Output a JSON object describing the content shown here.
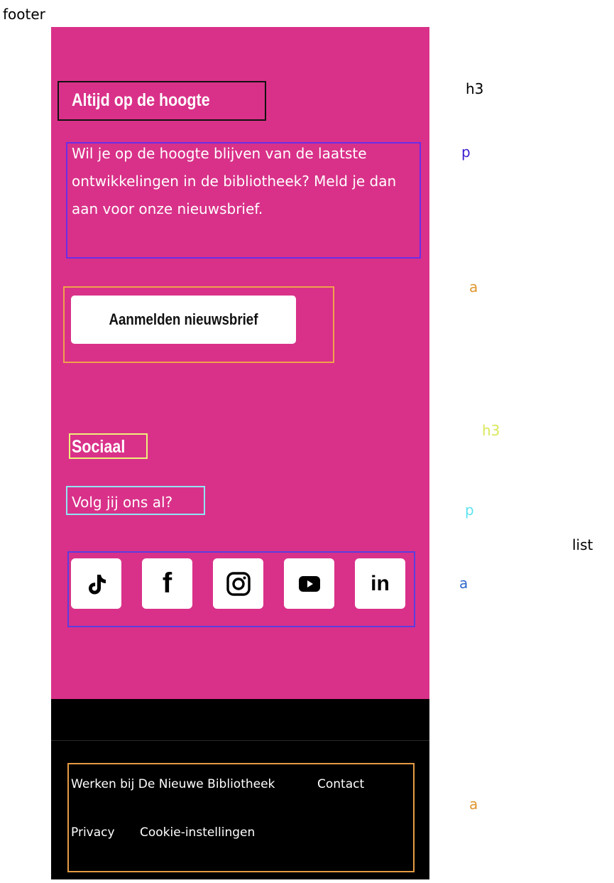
{
  "annotations": {
    "footer": "footer",
    "h3_news": "h3",
    "p_news": "p",
    "a_news": "a",
    "h3_social": "h3",
    "p_social": "p",
    "list": "list",
    "a_social": "a",
    "a_footer": "a"
  },
  "newsletter": {
    "title": "Altijd op de hoogte",
    "text": "Wil je op de hoogte blijven van de laatste ontwikkelingen in de bibliotheek? Meld je dan aan voor onze nieuwsbrief.",
    "button_label": "Aanmelden nieuwsbrief"
  },
  "social": {
    "title": "Sociaal",
    "text": "Volg jij ons al?",
    "icons": [
      "tiktok-icon",
      "facebook-icon",
      "instagram-icon",
      "youtube-icon",
      "linkedin-icon"
    ],
    "facebook_glyph": "f",
    "linkedin_glyph": "in"
  },
  "footer_links": [
    "Werken bij De Nieuwe Bibliotheek",
    "Contact",
    "Privacy",
    "Cookie-instellingen"
  ],
  "colors": {
    "pink_background": "#d93189",
    "footer_background": "#000000"
  }
}
